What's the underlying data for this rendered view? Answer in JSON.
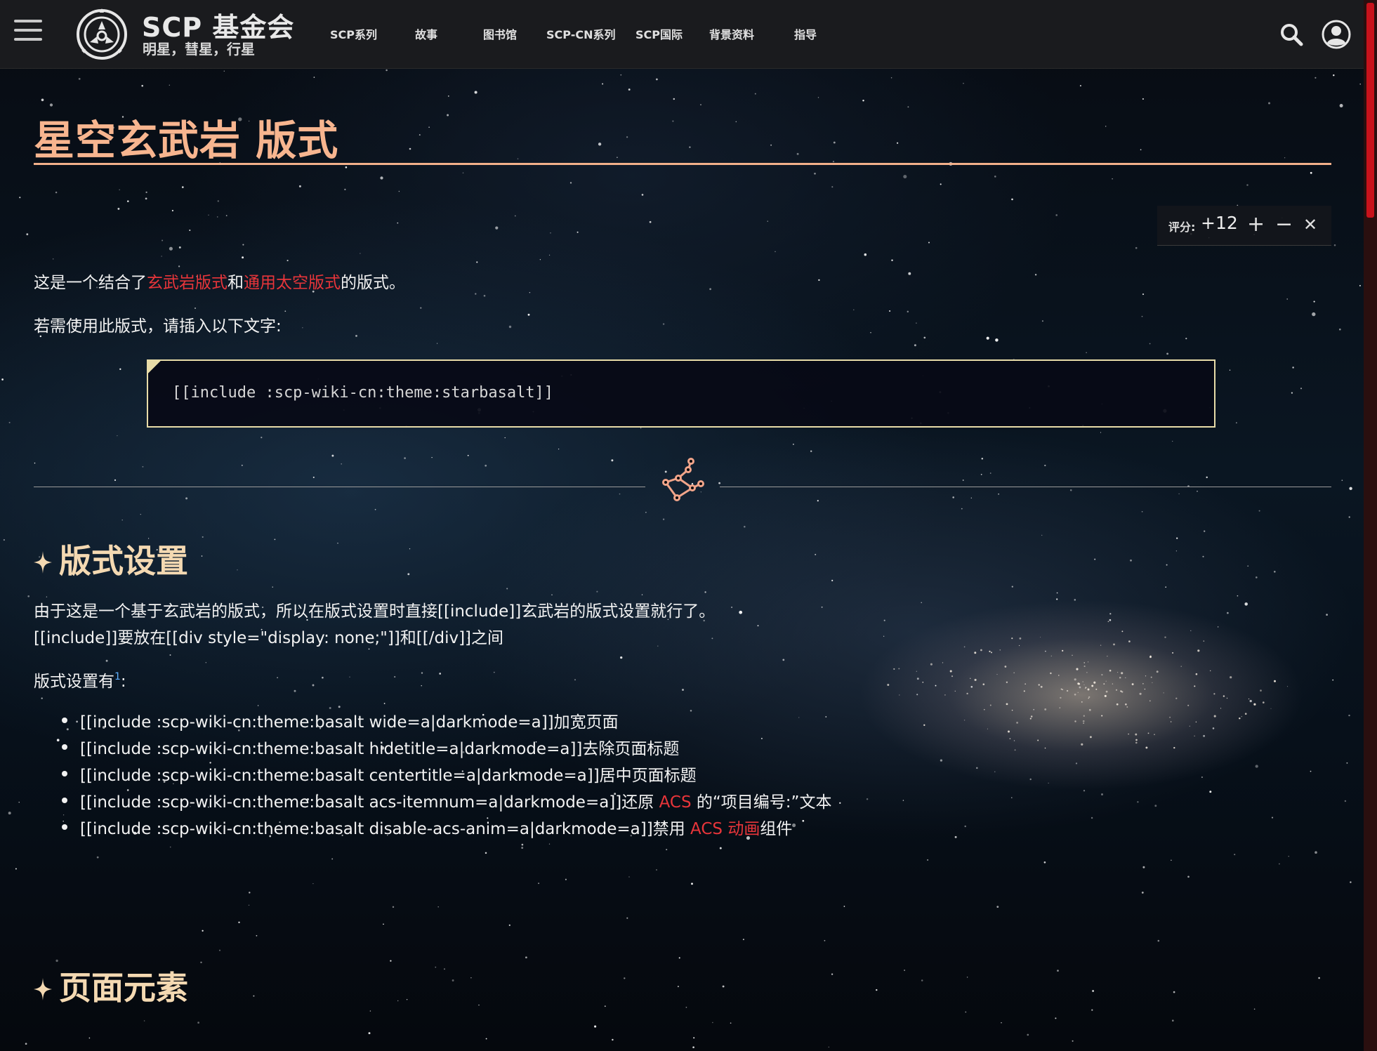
{
  "header": {
    "brand_title": "SCP 基金会",
    "brand_subtitle": "明星，彗星，行星",
    "nav": [
      {
        "label": "SCP系列"
      },
      {
        "label": "故事"
      },
      {
        "label": "图书馆"
      },
      {
        "label": "SCP-CN系列"
      },
      {
        "label": "SCP国际"
      },
      {
        "label": "背景资料"
      },
      {
        "label": "指导"
      }
    ],
    "icons": {
      "menu": "hamburger-menu-icon",
      "logo": "scp-logo-icon",
      "search": "search-icon",
      "user": "user-account-icon"
    }
  },
  "page": {
    "title": "星空玄武岩 版式",
    "rating": {
      "label": "评分:",
      "value": "+12",
      "upvote": "+",
      "downvote": "−",
      "cancel": "✕"
    },
    "intro": {
      "prefix": "这是一个结合了",
      "link1": "玄武岩版式",
      "mid": "和",
      "link2": "通用太空版式",
      "suffix": "的版式。"
    },
    "usage_text": "若需使用此版式，请插入以下文字:",
    "code": "[[include :scp-wiki-cn:theme:starbasalt]]",
    "section1": {
      "heading": "版式设置",
      "line1": "由于这是一个基于玄武岩的版式，所以在版式设置时直接[[include]]玄武岩的版式设置就行了。",
      "line2": "[[include]]要放在[[div style=\"display: none;\"]]和[[/div]]之间",
      "settings_label": "版式设置有",
      "footnote": "1",
      "settings_colon": ":",
      "items": [
        {
          "text": "[[include :scp-wiki-cn:theme:basalt wide=a|darkmode=a]]加宽页面"
        },
        {
          "text": "[[include :scp-wiki-cn:theme:basalt hidetitle=a|darkmode=a]]去除页面标题"
        },
        {
          "text": "[[include :scp-wiki-cn:theme:basalt centertitle=a|darkmode=a]]居中页面标题"
        },
        {
          "text": "[[include :scp-wiki-cn:theme:basalt acs-itemnum=a|darkmode=a]]还原 ",
          "link": "ACS",
          "after": " 的“项目编号:”文本"
        },
        {
          "text": "[[include :scp-wiki-cn:theme:basalt disable-acs-anim=a|darkmode=a]]禁用 ",
          "link": "ACS 动画",
          "after": "组件"
        }
      ]
    },
    "section2": {
      "heading": "页面元素"
    }
  },
  "colors": {
    "title": "#f7b58f",
    "heading": "#f4d9b2",
    "link": "#e8353a",
    "code_border": "#e8dca8",
    "scrollbar_thumb": "#c8121b",
    "topbar": "#1a1b1e"
  }
}
